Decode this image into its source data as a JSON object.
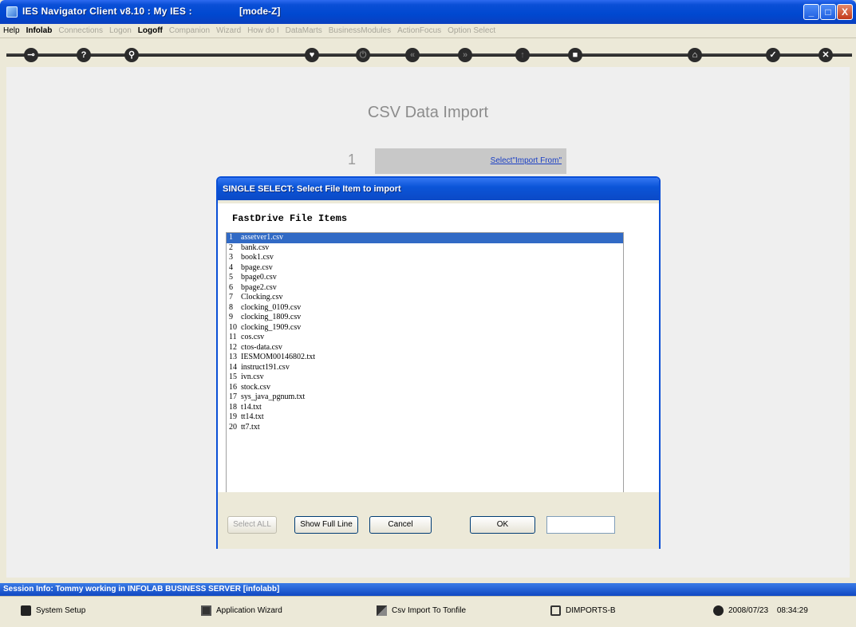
{
  "window": {
    "title": "IES Navigator Client v8.10 : My IES :",
    "mode": "[mode-Z]",
    "controls": {
      "minimize": "_",
      "maximize": "□",
      "close": "X"
    }
  },
  "menu": [
    {
      "label": "Help",
      "state": "on"
    },
    {
      "label": "Infolab",
      "state": "bold"
    },
    {
      "label": "Connections",
      "state": "off"
    },
    {
      "label": "Logon",
      "state": "off"
    },
    {
      "label": "Logoff",
      "state": "bold"
    },
    {
      "label": "Companion",
      "state": "off"
    },
    {
      "label": "Wizard",
      "state": "off"
    },
    {
      "label": "How do I",
      "state": "off"
    },
    {
      "label": "DataMarts",
      "state": "off"
    },
    {
      "label": "BusinessModules",
      "state": "off"
    },
    {
      "label": "ActionFocus",
      "state": "off"
    },
    {
      "label": "Option Select",
      "state": "off"
    }
  ],
  "toolbar": [
    {
      "name": "key-icon",
      "glyph": "⊸",
      "dim": false
    },
    {
      "name": "help-icon",
      "glyph": "?",
      "dim": false
    },
    {
      "name": "search-icon",
      "glyph": "⚲",
      "dim": false
    },
    {
      "name": "heart-icon",
      "glyph": "♥",
      "dim": false
    },
    {
      "name": "power-icon",
      "glyph": "⏻",
      "dim": true
    },
    {
      "name": "rewind-icon",
      "glyph": "«",
      "dim": true
    },
    {
      "name": "forward-icon",
      "glyph": "»",
      "dim": true
    },
    {
      "name": "up-icon",
      "glyph": "↑",
      "dim": true
    },
    {
      "name": "stop-icon",
      "glyph": "■",
      "dim": false
    },
    {
      "name": "home-icon",
      "glyph": "⌂",
      "dim": false
    },
    {
      "name": "check-icon",
      "glyph": "✓",
      "dim": false
    },
    {
      "name": "exit-icon",
      "glyph": "✕",
      "dim": false
    }
  ],
  "page": {
    "title": "CSV Data Import",
    "step_number": "1",
    "step_link": "Select\"Import From\""
  },
  "dialog": {
    "title": "SINGLE SELECT: Select File Item to import",
    "heading": "FastDrive File Items",
    "selected_index": 0,
    "items": [
      {
        "n": "1",
        "name": "assetver1.csv"
      },
      {
        "n": "2",
        "name": "bank.csv"
      },
      {
        "n": "3",
        "name": "book1.csv"
      },
      {
        "n": "4",
        "name": "bpage.csv"
      },
      {
        "n": "5",
        "name": "bpage0.csv"
      },
      {
        "n": "6",
        "name": "bpage2.csv"
      },
      {
        "n": "7",
        "name": "Clocking.csv"
      },
      {
        "n": "8",
        "name": "clocking_0109.csv"
      },
      {
        "n": "9",
        "name": "clocking_1809.csv"
      },
      {
        "n": "10",
        "name": "clocking_1909.csv"
      },
      {
        "n": "11",
        "name": "cos.csv"
      },
      {
        "n": "12",
        "name": "ctos-data.csv"
      },
      {
        "n": "13",
        "name": "IESMOM00146802.txt"
      },
      {
        "n": "14",
        "name": "instruct191.csv"
      },
      {
        "n": "15",
        "name": "ivn.csv"
      },
      {
        "n": "16",
        "name": "stock.csv"
      },
      {
        "n": "17",
        "name": "sys_java_pgnum.txt"
      },
      {
        "n": "18",
        "name": "t14.txt"
      },
      {
        "n": "19",
        "name": "tt14.txt"
      },
      {
        "n": "20",
        "name": "tt7.txt"
      }
    ],
    "buttons": {
      "select_all": "Select ALL",
      "show_full_line": "Show Full Line",
      "cancel": "Cancel",
      "ok": "OK"
    },
    "number_value": ""
  },
  "session": {
    "text": "Session Info: Tommy working in INFOLAB BUSINESS SERVER  [infolabb]"
  },
  "status": {
    "system_setup": "System Setup",
    "application_wizard": "Application Wizard",
    "csv_import": "Csv Import To Tonfile",
    "imports": "DIMPORTS-B",
    "date": "2008/07/23",
    "time": "08:34:29"
  },
  "colors": {
    "title_bar": "#0a4fd6",
    "selection": "#316ac5",
    "link": "#1a3fc4",
    "page_title": "#8c8c8c"
  }
}
